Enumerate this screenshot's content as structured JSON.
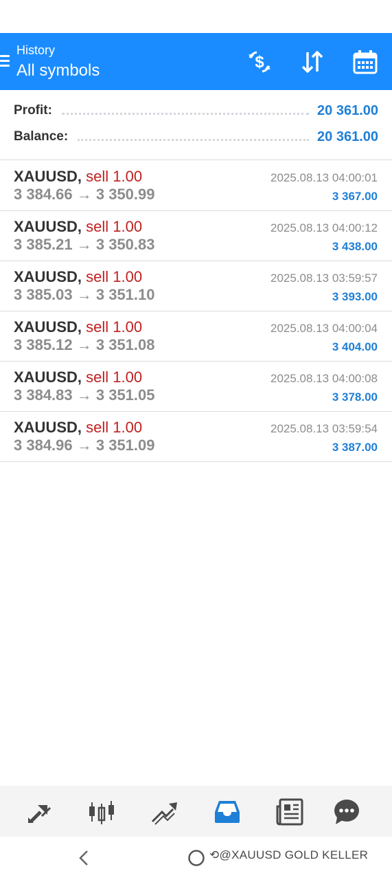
{
  "header": {
    "subtitle": "History",
    "title": "All symbols",
    "buttons": [
      {
        "icon": "currency-exchange-icon"
      },
      {
        "icon": "sort-icon"
      },
      {
        "icon": "calendar-icon"
      }
    ],
    "color": "#1a8cff"
  },
  "summary": {
    "profit_label": "Profit:",
    "profit_value": "20 361.00",
    "balance_label": "Balance:",
    "balance_value": "20 361.00"
  },
  "deals": [
    {
      "symbol": "XAUUSD,",
      "action": "sell 1.00",
      "prices": "3 384.66 → 3 350.99",
      "time": "2025.08.13 04:00:01",
      "profit": "3 367.00"
    },
    {
      "symbol": "XAUUSD,",
      "action": "sell 1.00",
      "prices": "3 385.21 → 3 350.83",
      "time": "2025.08.13 04:00:12",
      "profit": "3 438.00"
    },
    {
      "symbol": "XAUUSD,",
      "action": "sell 1.00",
      "prices": "3 385.03 → 3 351.10",
      "time": "2025.08.13 03:59:57",
      "profit": "3 393.00"
    },
    {
      "symbol": "XAUUSD,",
      "action": "sell 1.00",
      "prices": "3 385.12 → 3 351.08",
      "time": "2025.08.13 04:00:04",
      "profit": "3 404.00"
    },
    {
      "symbol": "XAUUSD,",
      "action": "sell 1.00",
      "prices": "3 384.83 → 3 351.05",
      "time": "2025.08.13 04:00:08",
      "profit": "3 378.00"
    },
    {
      "symbol": "XAUUSD,",
      "action": "sell 1.00",
      "prices": "3 384.96 → 3 351.09",
      "time": "2025.08.13 03:59:54",
      "profit": "3 387.00"
    }
  ],
  "bottom_nav": [
    {
      "icon": "quotes-icon",
      "active": false
    },
    {
      "icon": "chart-icon",
      "active": false
    },
    {
      "icon": "trade-icon",
      "active": false
    },
    {
      "icon": "history-icon",
      "active": true
    },
    {
      "icon": "news-icon",
      "active": false
    },
    {
      "icon": "messages-icon",
      "active": false
    }
  ],
  "system_nav": {
    "back_icon": "back-icon",
    "home_icon": "home-icon"
  },
  "watermark": "@XAUUSD GOLD KELLER",
  "colors": {
    "accent": "#1a8cff",
    "profit": "#1e7fd6",
    "sell": "#c02020",
    "muted": "#8c8c8c",
    "nav_active": "#1e7fd6",
    "nav_inactive": "#4a4a4a"
  }
}
